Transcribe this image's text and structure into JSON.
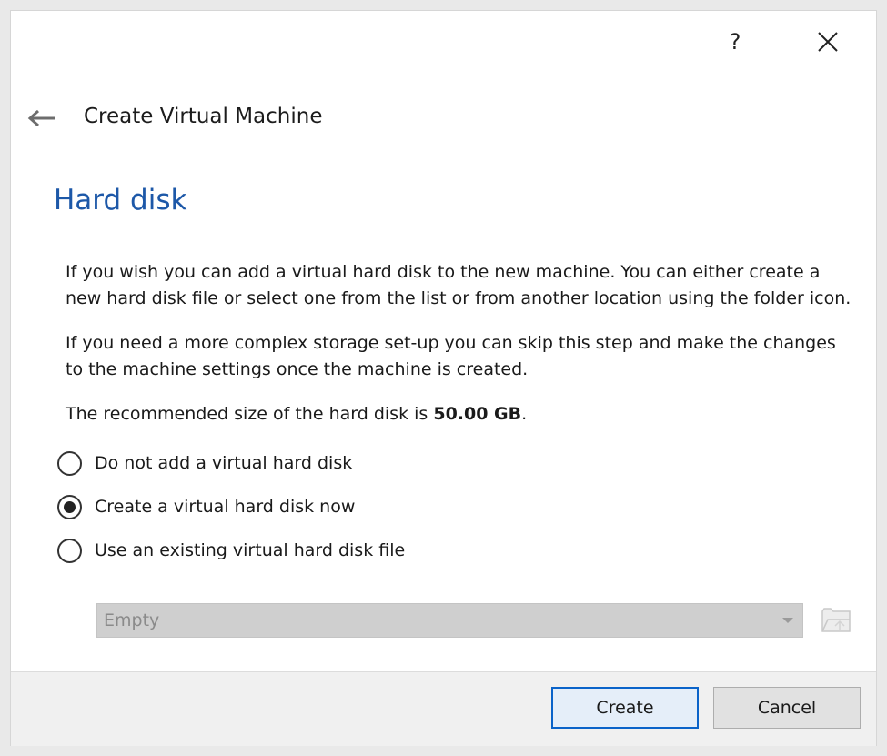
{
  "window": {
    "help_label": "?",
    "title": "Create Virtual Machine"
  },
  "page": {
    "heading": "Hard disk",
    "para1": "If you wish you can add a virtual hard disk to the new machine. You can either create a new hard disk file or select one from the list or from another location using the folder icon.",
    "para2": "If you need a more complex storage set-up you can skip this step and make the changes to the machine settings once the machine is created.",
    "recommend_prefix": "The recommended size of the hard disk is ",
    "recommend_value": "50.00 GB",
    "recommend_suffix": "."
  },
  "options": {
    "items": [
      {
        "label": "Do not add a virtual hard disk",
        "checked": false
      },
      {
        "label": "Create a virtual hard disk now",
        "checked": true
      },
      {
        "label": "Use an existing virtual hard disk file",
        "checked": false
      }
    ]
  },
  "disk_select": {
    "value": "Empty",
    "enabled": false
  },
  "buttons": {
    "create": "Create",
    "cancel": "Cancel"
  },
  "colors": {
    "heading": "#1d58a8",
    "default_button_border": "#0a63c9"
  },
  "icons": {
    "back": "arrow-left-icon",
    "close": "close-icon",
    "folder": "folder-icon",
    "dropdown": "chevron-down-icon"
  }
}
